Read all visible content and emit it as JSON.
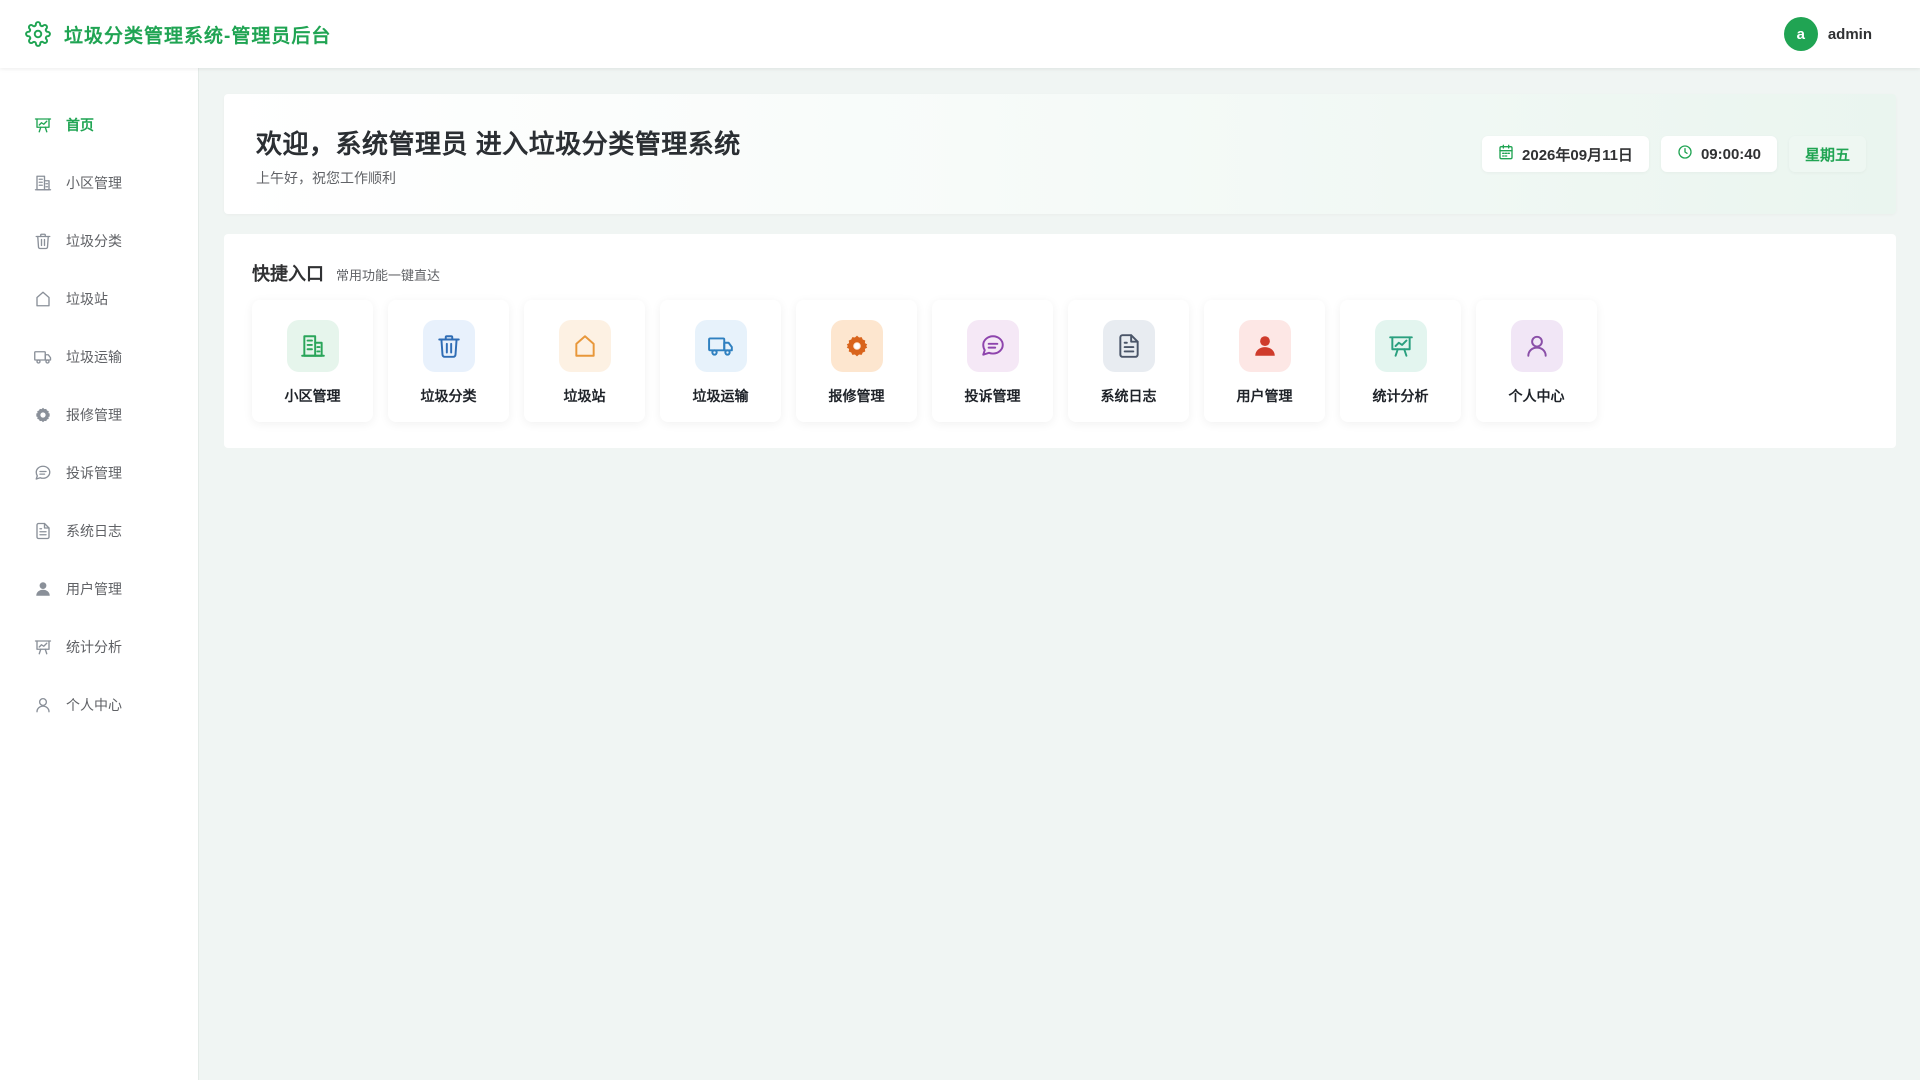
{
  "header": {
    "title": "垃圾分类管理系统-管理员后台",
    "logo_icon": "gear-icon",
    "avatar_letter": "a",
    "username": "admin",
    "accent_color": "#20a453"
  },
  "sidebar": {
    "items": [
      {
        "label": "首页",
        "icon": "presentation-icon",
        "active": true
      },
      {
        "label": "小区管理",
        "icon": "building-icon"
      },
      {
        "label": "垃圾分类",
        "icon": "trash-icon"
      },
      {
        "label": "垃圾站",
        "icon": "house-icon"
      },
      {
        "label": "垃圾运输",
        "icon": "truck-icon"
      },
      {
        "label": "报修管理",
        "icon": "cog-icon"
      },
      {
        "label": "投诉管理",
        "icon": "chat-bubble-icon"
      },
      {
        "label": "系统日志",
        "icon": "document-icon"
      },
      {
        "label": "用户管理",
        "icon": "user-filled-icon"
      },
      {
        "label": "统计分析",
        "icon": "presentation-icon"
      },
      {
        "label": "个人中心",
        "icon": "user-outline-icon"
      }
    ]
  },
  "welcome": {
    "title": "欢迎，系统管理员 进入垃圾分类管理系统",
    "subtitle": "上午好，祝您工作顺利",
    "date": "2026年09月11日",
    "time": "09:00:40",
    "weekday": "星期五"
  },
  "quick": {
    "title": "快捷入口",
    "subtitle": "常用功能一键直达",
    "items": [
      {
        "label": "小区管理",
        "icon": "building-icon",
        "color": "#2aa55a",
        "bg": "#e6f5ec"
      },
      {
        "label": "垃圾分类",
        "icon": "trash-icon",
        "color": "#2f6db5",
        "bg": "#e8f1fc"
      },
      {
        "label": "垃圾站",
        "icon": "house-icon",
        "color": "#e8973a",
        "bg": "#fdf1e3"
      },
      {
        "label": "垃圾运输",
        "icon": "truck-icon",
        "color": "#2f80c0",
        "bg": "#e7f2fb"
      },
      {
        "label": "报修管理",
        "icon": "cog-icon",
        "color": "#d9641c",
        "bg": "#fde6cf"
      },
      {
        "label": "投诉管理",
        "icon": "chat-bubble-icon",
        "color": "#8e44ad",
        "bg": "#f5e8f6"
      },
      {
        "label": "系统日志",
        "icon": "document-icon",
        "color": "#4a5568",
        "bg": "#e8ecf1"
      },
      {
        "label": "用户管理",
        "icon": "user-filled-icon",
        "color": "#cf3b2c",
        "bg": "#fde7e5"
      },
      {
        "label": "统计分析",
        "icon": "presentation-icon",
        "color": "#2aa07f",
        "bg": "#e3f5ef"
      },
      {
        "label": "个人中心",
        "icon": "user-outline-icon",
        "color": "#8a4fa8",
        "bg": "#f1e6f6"
      }
    ]
  }
}
